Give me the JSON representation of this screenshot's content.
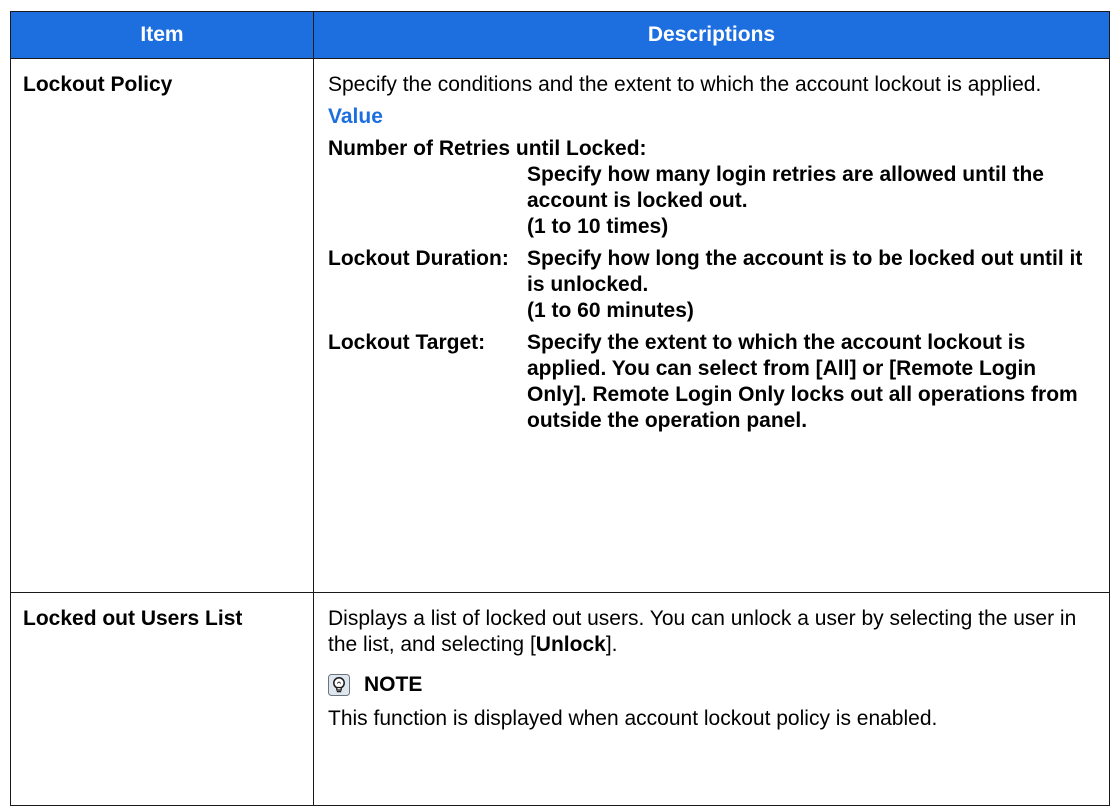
{
  "table": {
    "headers": {
      "item": "Item",
      "descriptions": "Descriptions"
    },
    "rows": [
      {
        "item": "Lockout Policy",
        "intro": "Specify the conditions and the extent to which the account lockout is applied.",
        "value_heading": "Value",
        "values": [
          {
            "label": "Number of Retries until Locked:",
            "description": "Specify how many login retries are allowed until the account is locked out.",
            "range": "(1 to 10 times)"
          },
          {
            "label": "Lockout Duration:",
            "description": "Specify how long the account is to be locked out until it is unlocked.",
            "range": "(1 to 60 minutes)"
          },
          {
            "label": "Lockout Target:",
            "description": "Specify the extent to which the account lockout is applied. You can select from [All] or [Remote Login Only]. Remote Login Only locks out all operations from outside the operation panel."
          }
        ]
      },
      {
        "item": "Locked out Users List",
        "desc_before": "Displays a list of locked out users. You can unlock a user by selecting the user in the list, and selecting [",
        "desc_bold": "Unlock",
        "desc_after": "].",
        "note_title": "NOTE",
        "note_text": "This function is displayed when account lockout policy is enabled."
      }
    ]
  },
  "colors": {
    "header_bg": "#1d6fe0",
    "accent_text": "#1d6fe0",
    "border": "#1a1a1a"
  },
  "icons": {
    "note": "lightbulb-note-icon"
  }
}
